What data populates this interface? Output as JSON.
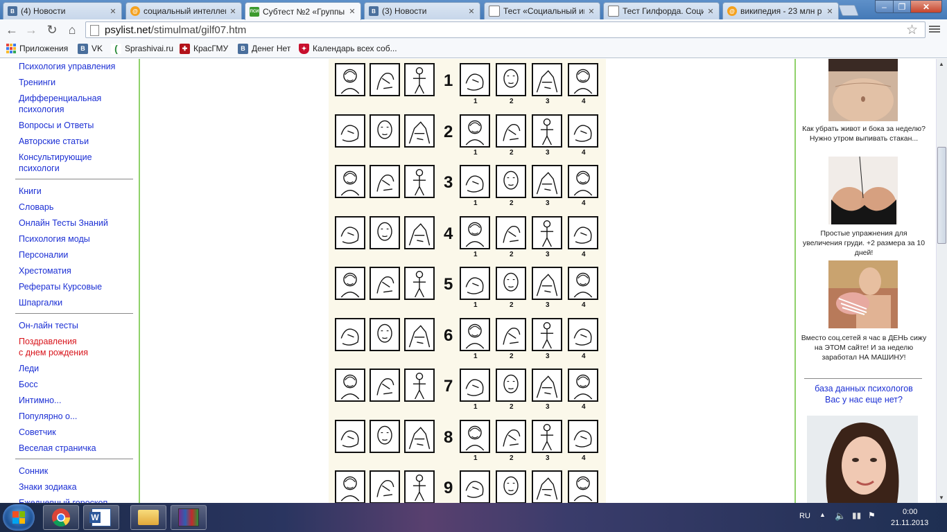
{
  "browser": {
    "tabs": [
      {
        "title": "(4) Новости",
        "favicon": "vk-icon"
      },
      {
        "title": "социальный интеллект",
        "favicon": "mail-search-icon"
      },
      {
        "title": "Субтест №2 «Группы",
        "favicon": "psi-icon"
      },
      {
        "title": "(3) Новости",
        "favicon": "vk-icon"
      },
      {
        "title": "Тест «Социальный ин",
        "favicon": "page-icon"
      },
      {
        "title": "Тест Гилфорда. Соци",
        "favicon": "doc-icon"
      },
      {
        "title": "википедия - 23 млн р",
        "favicon": "mail-search-icon"
      }
    ],
    "url_domain": "psylist.net",
    "url_path": "/stimulmat/gilf07.htm",
    "bookmarks": [
      {
        "label": "Приложения",
        "icon": "apps-icon"
      },
      {
        "label": "VK",
        "icon": "vk-icon"
      },
      {
        "label": "Sprashivai.ru",
        "icon": "sprashivai-icon"
      },
      {
        "label": "КрасГМУ",
        "icon": "krasgmu-icon"
      },
      {
        "label": "Денег Нет",
        "icon": "vk-icon"
      },
      {
        "label": "Календарь всех соб...",
        "icon": "calendar-icon"
      }
    ],
    "psi_favicon_text": "ПСИ"
  },
  "left_nav": {
    "group1": [
      "Психология управления",
      "Тренинги",
      "Дифференциальная",
      "психология",
      "Вопросы и Ответы",
      "Авторские статьи",
      "Консультирующие",
      "психологи"
    ],
    "group2": [
      "Книги",
      "Словарь",
      "Онлайн Тесты Знаний",
      "Психология моды",
      "Персоналии",
      "Хрестоматия",
      "Рефераты Курсовые",
      "Шпаргалки"
    ],
    "group3": [
      "Он-лайн тесты",
      "Поздравления",
      "с днем рождения",
      "Леди",
      "Босс",
      "Интимно...",
      "Популярно о...",
      "Советчик",
      "Веселая страничка"
    ],
    "group4": [
      "Сонник",
      "Знаки зодиака",
      "Ежедневный гороскоп"
    ]
  },
  "stimulus": {
    "row_numbers": [
      "1",
      "2",
      "3",
      "4",
      "5",
      "6",
      "7",
      "8",
      "9"
    ],
    "option_numbers": [
      "1",
      "2",
      "3",
      "4"
    ]
  },
  "right_col": {
    "ads": [
      "Как убрать живот и бока за неделю? Нужно утром выпивать стакан...",
      "Простые упражнения для увеличения груди. +2 размера за 10 дней!",
      "Вместо соц.сетей я час в ДЕНЬ сижу на ЭТОМ сайте! И за неделю заработал НА МАШИНУ!"
    ],
    "db_line1": "база данных психологов",
    "db_line2": "Вас у нас еще нет?"
  },
  "taskbar": {
    "lang": "RU",
    "time": "0:00",
    "date": "21.11.2013"
  }
}
